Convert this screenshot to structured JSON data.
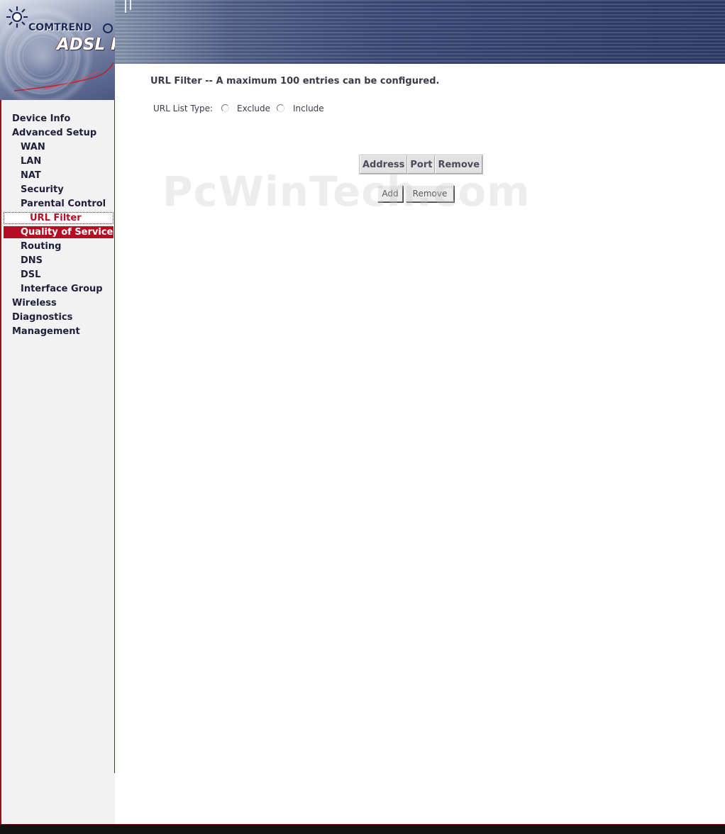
{
  "header": {
    "brand": "COMTREND",
    "product": "ADSL Router"
  },
  "sidebar": {
    "items": [
      {
        "label": "Device Info",
        "level": 0,
        "state": "normal"
      },
      {
        "label": "Advanced Setup",
        "level": 0,
        "state": "normal"
      },
      {
        "label": "WAN",
        "level": 1,
        "state": "normal"
      },
      {
        "label": "LAN",
        "level": 1,
        "state": "normal"
      },
      {
        "label": "NAT",
        "level": 1,
        "state": "normal"
      },
      {
        "label": "Security",
        "level": 1,
        "state": "normal"
      },
      {
        "label": "Parental Control",
        "level": 1,
        "state": "normal"
      },
      {
        "label": "URL Filter",
        "level": 2,
        "state": "selected"
      },
      {
        "label": "Quality of Service",
        "level": 1,
        "state": "hover"
      },
      {
        "label": "Routing",
        "level": 1,
        "state": "normal"
      },
      {
        "label": "DNS",
        "level": 1,
        "state": "normal"
      },
      {
        "label": "DSL",
        "level": 1,
        "state": "normal"
      },
      {
        "label": "Interface Group",
        "level": 1,
        "state": "normal"
      },
      {
        "label": "Wireless",
        "level": 0,
        "state": "normal"
      },
      {
        "label": "Diagnostics",
        "level": 0,
        "state": "normal"
      },
      {
        "label": "Management",
        "level": 0,
        "state": "normal"
      }
    ]
  },
  "main": {
    "heading": "URL Filter -- A maximum 100 entries can be configured.",
    "list_type": {
      "label": "URL List Type:",
      "options": [
        {
          "label": "Exclude",
          "checked": false
        },
        {
          "label": "Include",
          "checked": false
        }
      ]
    },
    "table": {
      "headers": [
        "Address",
        "Port",
        "Remove"
      ],
      "rows": []
    },
    "buttons": {
      "add": "Add",
      "remove": "Remove"
    }
  },
  "watermark": "PcWinTech.com",
  "colors": {
    "accent": "#b50d22",
    "sidebar_bg": "#f2f2f2",
    "header_bg": "#3a4a78"
  }
}
